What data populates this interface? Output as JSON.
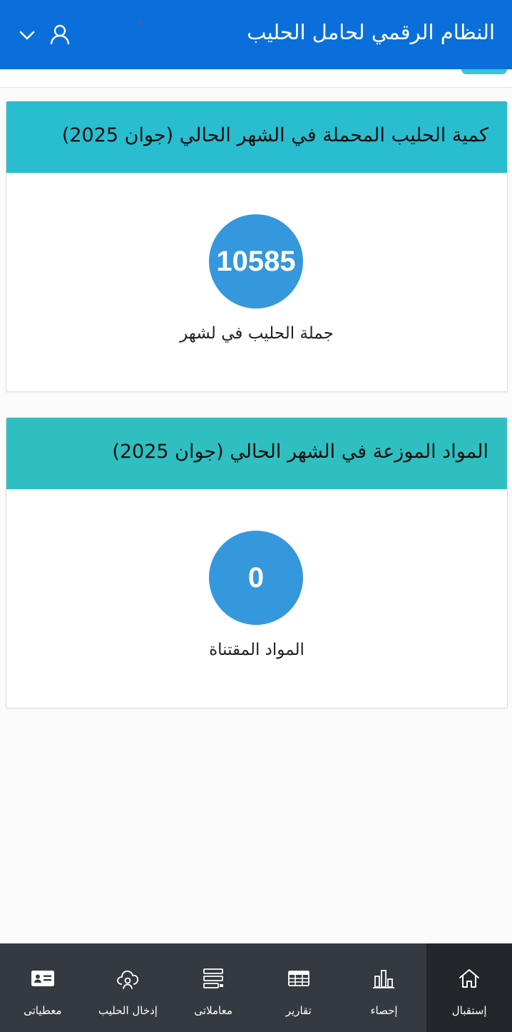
{
  "header": {
    "title": "النظام الرقمي لحامل الحليب"
  },
  "cards": [
    {
      "title": "كمية الحليب المحملة في الشهر الحالي (جوان 2025)",
      "value": "10585",
      "caption": "جملة الحليب في لشهر",
      "header_color": "#29bdd0"
    },
    {
      "title": "المواد الموزعة في الشهر الحالي (جوان 2025)",
      "value": "0",
      "caption": "المواد المقتناة",
      "header_color": "#2fbfc0"
    }
  ],
  "bottom_nav": {
    "items": [
      {
        "label": "إستقبال",
        "icon": "home-icon",
        "active": true
      },
      {
        "label": "إحصاء",
        "icon": "bar-chart-icon",
        "active": false
      },
      {
        "label": "تقارير",
        "icon": "table-icon",
        "active": false
      },
      {
        "label": "معاملاتى",
        "icon": "list-icon",
        "active": false
      },
      {
        "label": "إدخال الحليب",
        "icon": "cloud-user-icon",
        "active": false
      },
      {
        "label": "معطياتى",
        "icon": "id-card-icon",
        "active": false
      }
    ]
  },
  "colors": {
    "header_bg": "#0a6fdb",
    "circle": "#3598dc",
    "nav_bg": "#343a40",
    "nav_active": "#23272b"
  }
}
